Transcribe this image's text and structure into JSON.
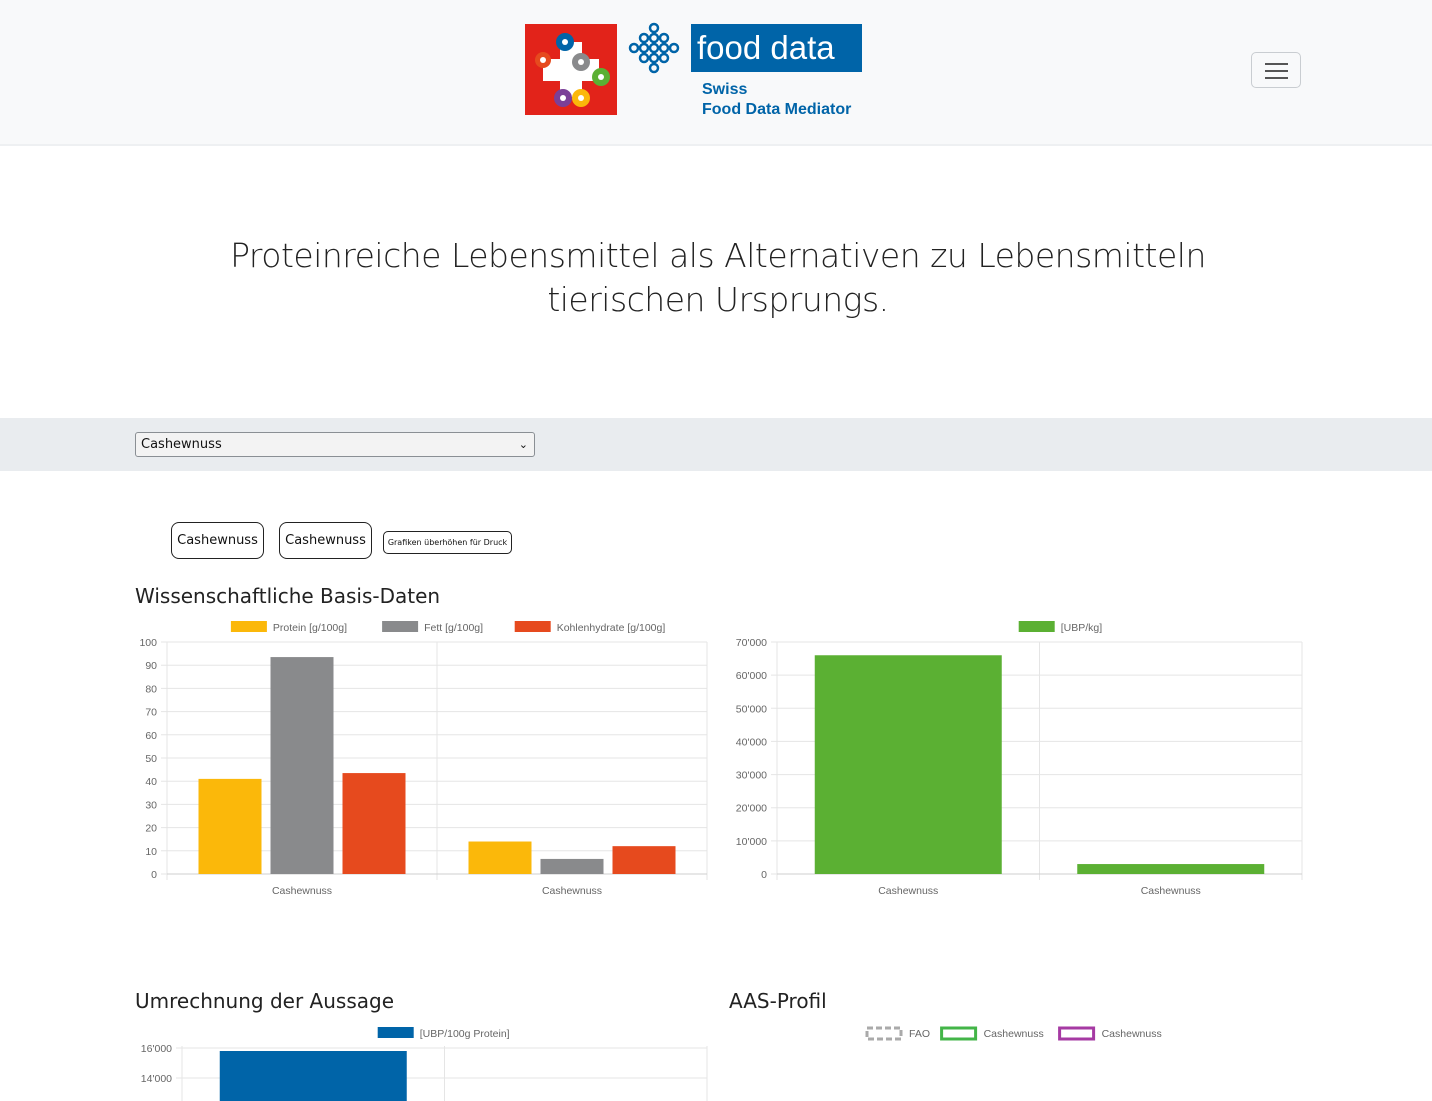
{
  "header": {
    "logo_text": "food data",
    "logo_sub_line1": "Swiss",
    "logo_sub_line2": "Food Data Mediator"
  },
  "hero": {
    "title_line1": "Proteinreiche Lebensmittel als Alternativen zu Lebensmitteln",
    "title_line2": "tierischen Ursprungs."
  },
  "selector": {
    "value": "Cashewnuss"
  },
  "buttons": {
    "item1": "Cashewnuss",
    "item2": "Cashewnuss",
    "print": "Grafiken überhöhen für Druck"
  },
  "sections": {
    "basis": "Wissenschaftliche Basis-Daten",
    "umrechnung": "Umrechnung der Aussage",
    "aas": "AAS-Profil"
  },
  "colors": {
    "protein": "#fbb80a",
    "fett": "#898a8c",
    "kohlenhydrate": "#e64a1e",
    "ubp": "#5bb033",
    "ubp_protein": "#0064a8",
    "aas_1": "#43b548",
    "aas_2": "#a63aa3"
  },
  "chart_data": [
    {
      "type": "bar",
      "categories": [
        "Cashewnuss",
        "Cashewnuss"
      ],
      "series": [
        {
          "name": "Protein [g/100g]",
          "values": [
            41,
            14
          ]
        },
        {
          "name": "Fett [g/100g]",
          "values": [
            93.5,
            6.5
          ]
        },
        {
          "name": "Kohlenhydrate [g/100g]",
          "values": [
            43.5,
            12
          ]
        }
      ],
      "yticks": [
        "0",
        "10",
        "20",
        "30",
        "40",
        "50",
        "60",
        "70",
        "80",
        "90",
        "100"
      ],
      "ylim": [
        0,
        100
      ],
      "legend": "top"
    },
    {
      "type": "bar",
      "categories": [
        "Cashewnuss",
        "Cashewnuss"
      ],
      "series": [
        {
          "name": "[UBP/kg]",
          "values": [
            66000,
            3000
          ]
        }
      ],
      "yticks": [
        "0",
        "10'000",
        "20'000",
        "30'000",
        "40'000",
        "50'000",
        "60'000",
        "70'000"
      ],
      "ylim": [
        0,
        70000
      ],
      "legend": "top"
    },
    {
      "type": "bar",
      "categories": [
        "Cashewnuss",
        "Cashewnuss"
      ],
      "series": [
        {
          "name": "[UBP/100g Protein]",
          "values": [
            15800,
            null
          ]
        }
      ],
      "yticks": [
        "14'000",
        "16'000"
      ],
      "ylim": [
        14000,
        16000
      ],
      "legend": "top"
    },
    {
      "type": "radar",
      "legend_entries": [
        "FAO",
        "Cashewnuss",
        "Cashewnuss"
      ],
      "legend": "top"
    }
  ]
}
